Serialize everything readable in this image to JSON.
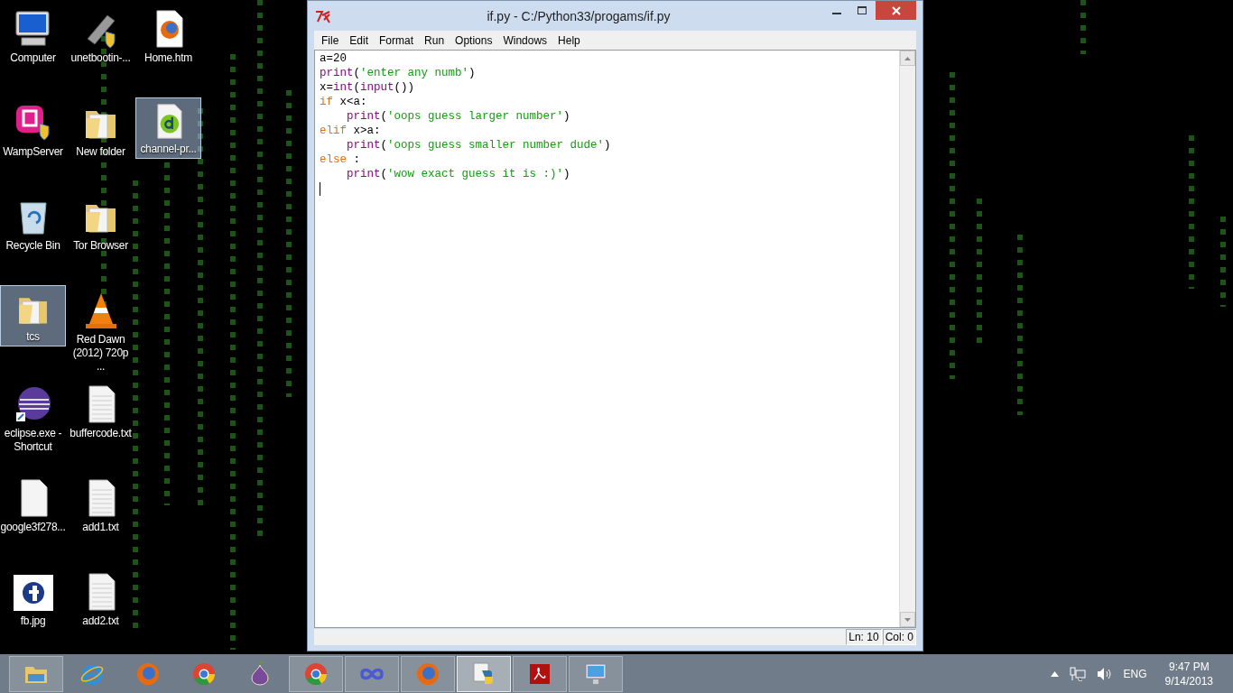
{
  "desktop": {
    "icons": [
      {
        "label": "Computer",
        "kind": "computer",
        "selected": false
      },
      {
        "label": "WampServer",
        "kind": "wamp",
        "selected": false
      },
      {
        "label": "Recycle Bin",
        "kind": "recycle",
        "selected": false
      },
      {
        "label": "tcs",
        "kind": "folder",
        "selected": true
      },
      {
        "label": "eclipse.exe - Shortcut",
        "kind": "eclipse",
        "selected": false
      },
      {
        "label": "google3f278...",
        "kind": "blank",
        "selected": false
      },
      {
        "label": "fb.jpg",
        "kind": "image",
        "selected": false
      },
      {
        "label": "unetbootin-...",
        "kind": "usb",
        "selected": false
      },
      {
        "label": "New folder",
        "kind": "folder",
        "selected": false
      },
      {
        "label": "Tor Browser",
        "kind": "folder",
        "selected": false
      },
      {
        "label": "Red Dawn (2012) 720p ...",
        "kind": "cone",
        "selected": false
      },
      {
        "label": "buffercode.txt",
        "kind": "text",
        "selected": false
      },
      {
        "label": "add1.txt",
        "kind": "text",
        "selected": false
      },
      {
        "label": "add2.txt",
        "kind": "text",
        "selected": false
      },
      {
        "label": "Home.htm",
        "kind": "web",
        "selected": false
      },
      {
        "label": "channel-pr...",
        "kind": "dw",
        "selected": true
      }
    ]
  },
  "window": {
    "title": "if.py - C:/Python33/progams/if.py",
    "menu": [
      "File",
      "Edit",
      "Format",
      "Run",
      "Options",
      "Windows",
      "Help"
    ],
    "code": [
      {
        "segments": [
          {
            "kind": "plain",
            "text": "a=20"
          }
        ]
      },
      {
        "segments": [
          {
            "kind": "builtin",
            "text": "print"
          },
          {
            "kind": "plain",
            "text": "("
          },
          {
            "kind": "string",
            "text": "'enter any numb'"
          },
          {
            "kind": "plain",
            "text": ")"
          }
        ]
      },
      {
        "segments": [
          {
            "kind": "plain",
            "text": "x="
          },
          {
            "kind": "builtin",
            "text": "int"
          },
          {
            "kind": "plain",
            "text": "("
          },
          {
            "kind": "builtin",
            "text": "input"
          },
          {
            "kind": "plain",
            "text": "())"
          }
        ]
      },
      {
        "segments": [
          {
            "kind": "keyword",
            "text": "if"
          },
          {
            "kind": "plain",
            "text": " x<a:"
          }
        ],
        "children": [
          {
            "segments": [
              {
                "kind": "builtin",
                "text": "print"
              },
              {
                "kind": "plain",
                "text": "("
              },
              {
                "kind": "string",
                "text": "'oops guess larger number'"
              },
              {
                "kind": "plain",
                "text": ")"
              }
            ]
          }
        ]
      },
      {
        "segments": [
          {
            "kind": "keyword",
            "text": "elif"
          },
          {
            "kind": "plain",
            "text": " x>a:"
          }
        ],
        "children": [
          {
            "segments": [
              {
                "kind": "builtin",
                "text": "print"
              },
              {
                "kind": "plain",
                "text": "("
              },
              {
                "kind": "string",
                "text": "'oops guess smaller number dude'"
              },
              {
                "kind": "plain",
                "text": ")"
              }
            ]
          }
        ]
      },
      {
        "segments": [
          {
            "kind": "keyword",
            "text": "else"
          },
          {
            "kind": "plain",
            "text": " :"
          }
        ],
        "children": [
          {
            "segments": [
              {
                "kind": "builtin",
                "text": "print"
              },
              {
                "kind": "plain",
                "text": "("
              },
              {
                "kind": "string",
                "text": "'wow exact guess it is :)'"
              },
              {
                "kind": "plain",
                "text": ")"
              }
            ]
          }
        ]
      }
    ],
    "status": [
      "Ln: 10",
      "Col: 0"
    ]
  },
  "taskbar": {
    "items": [
      {
        "kind": "explorer",
        "running": true,
        "selected": false
      },
      {
        "kind": "ie",
        "running": false,
        "selected": false
      },
      {
        "kind": "firefox",
        "running": false,
        "selected": false
      },
      {
        "kind": "chrome",
        "running": false,
        "selected": false
      },
      {
        "kind": "tor",
        "running": false,
        "selected": false
      },
      {
        "kind": "chrome",
        "running": true,
        "selected": false
      },
      {
        "kind": "infinity",
        "running": true,
        "selected": false
      },
      {
        "kind": "firefox",
        "running": true,
        "selected": false
      },
      {
        "kind": "python",
        "running": true,
        "selected": true
      },
      {
        "kind": "pdf",
        "running": true,
        "selected": false
      },
      {
        "kind": "remote",
        "running": true,
        "selected": false
      }
    ],
    "tray": {
      "language": "ENG",
      "time": "9:47 PM",
      "date": "9/14/2013"
    }
  }
}
